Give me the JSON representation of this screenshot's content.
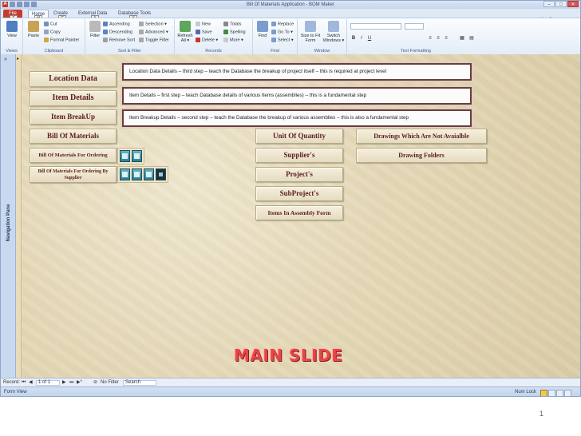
{
  "window": {
    "title": "Bill Of Materials Application  -  BOM Maker",
    "controls": [
      "–",
      "□",
      "✕"
    ]
  },
  "tabs": [
    {
      "label": "File",
      "keytip": "F"
    },
    {
      "label": "Home",
      "keytip": "H"
    },
    {
      "label": "Create",
      "keytip": "C"
    },
    {
      "label": "External Data",
      "keytip": "X"
    },
    {
      "label": "Database Tools",
      "keytip": "Y"
    }
  ],
  "ribbon": {
    "views": {
      "label": "Views",
      "view_btn": "View"
    },
    "clipboard": {
      "label": "Clipboard",
      "paste": "Paste",
      "cut": "Cut",
      "copy": "Copy",
      "format_painter": "Format Painter"
    },
    "sort_filter": {
      "label": "Sort & Filter",
      "filter": "Filter",
      "ascending": "Ascending",
      "descending": "Descending",
      "remove_sort": "Remove Sort",
      "selection": "Selection ▾",
      "advanced": "Advanced ▾",
      "toggle_filter": "Toggle Filter"
    },
    "records": {
      "label": "Records",
      "refresh": "Refresh All ▾",
      "new": "New",
      "save": "Save",
      "delete": "Delete ▾",
      "totals": "Totals",
      "spelling": "Spelling",
      "more": "More ▾"
    },
    "find": {
      "label": "Find",
      "find_btn": "Find",
      "replace": "Replace",
      "goto": "Go To ▾",
      "select": "Select ▾"
    },
    "window": {
      "label": "Window",
      "size_fit": "Size to Fit Form",
      "switch": "Switch Windows ▾"
    },
    "text_formatting": {
      "label": "Text Formatting",
      "bold": "B",
      "italic": "I",
      "underline": "U"
    }
  },
  "nav_pane": {
    "label": "Navigation Pane",
    "chevron": "»"
  },
  "form": {
    "left_buttons": {
      "location_data": "Location Data",
      "item_details": "Item Details",
      "item_breakup": "Item BreakUp",
      "bill_of_materials": "Bill Of Materials",
      "bom_ordering": "Bill Of Materials For Ordering",
      "bom_ordering_supplier": "Bill Of Materials For Ordering By Supplier"
    },
    "center_buttons": {
      "unit_of_quantity": "Unit Of Quantity",
      "suppliers": "Supplier's",
      "projects": "Project's",
      "subprojects": "SubProject's",
      "items_in_assembly": "Items In Assembly Form"
    },
    "right_buttons": {
      "drawings_not_available": "Drawings Which Are Not Avaialble",
      "drawing_folders": "Drawing Folders"
    }
  },
  "callouts": {
    "location": "Location Data Details – third step – teach the Database the breakup of project itself – this is required at project level",
    "item_details": "Item Details – first step – teach Database details of various Items (assemblies) – this is a fundamental step",
    "item_breakup": "Item Breakup Details – second step – teach the Database the breakup of various assemblies – this is also a fundamental step"
  },
  "slide_title": "MAIN SLIDE",
  "record_nav": {
    "record_label": "Record:",
    "position": "1 of 1",
    "no_filter": "No Filter",
    "search": "Search"
  },
  "status": {
    "left": "Form View",
    "num_lock": "Num Lock"
  },
  "slide_number": "1"
}
